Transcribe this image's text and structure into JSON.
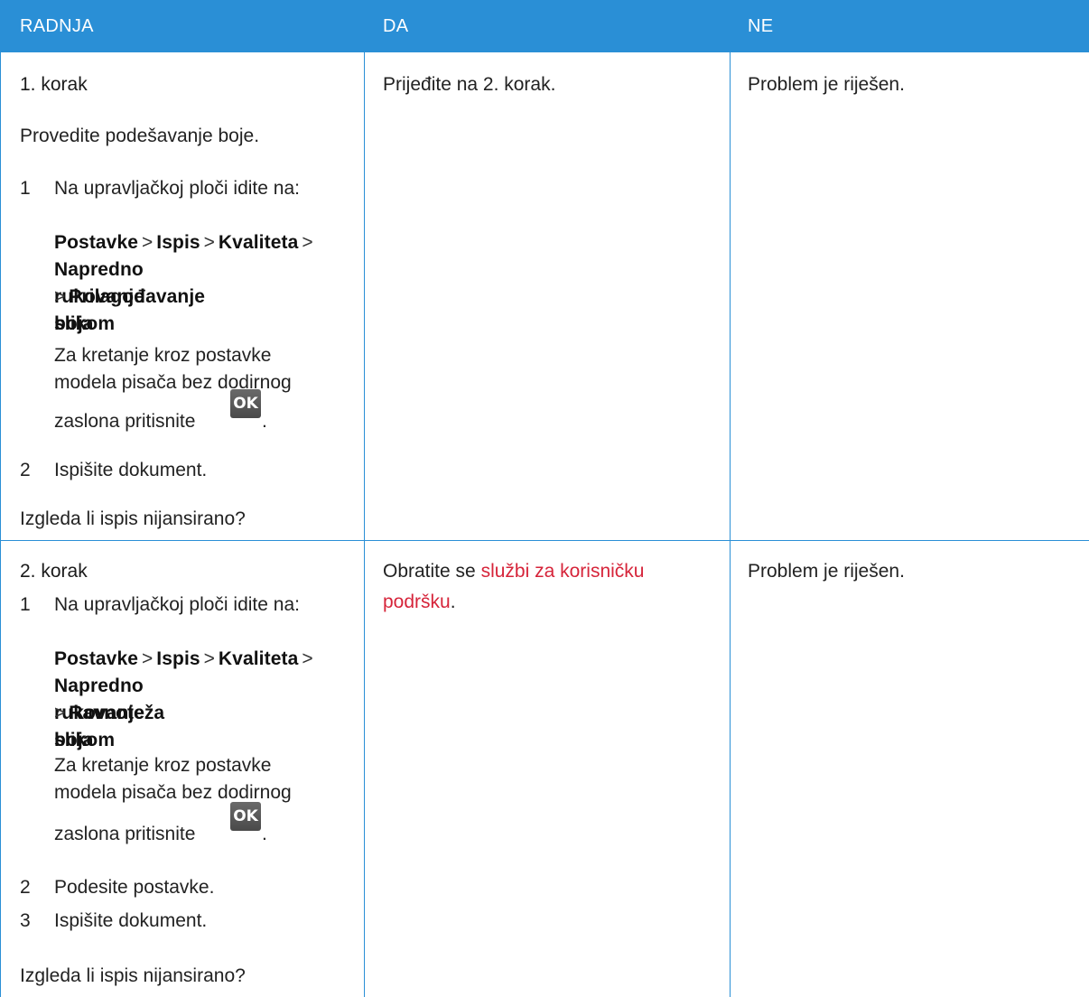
{
  "header": {
    "col1": "RADNJA",
    "col2": "DA",
    "col3": "NE"
  },
  "row1": {
    "step": "1. korak",
    "intro": "Provedite podešavanje boje.",
    "item1_num": "1",
    "item1_text": "Na upravljačkoj ploči idite na:",
    "path_line1_a": "Postavke",
    "path_line1_b": "Ispis",
    "path_line1_c": "Kvaliteta",
    "path_line2": "Napredno rukovanje slikom",
    "path_line3": "Prilagođavanje boja",
    "nontouch_line1": "Za kretanje kroz postavke",
    "nontouch_line2": "modela pisača bez dodirnog",
    "nontouch_line3": "zaslona pritisnite",
    "ok_label": "OK",
    "period": ".",
    "item2_num": "2",
    "item2_text": "Ispišite dokument.",
    "question": "Izgleda li ispis nijansirano?",
    "yes": "Prijeđite na 2. korak.",
    "no": "Problem je riješen."
  },
  "row2": {
    "step": "2. korak",
    "item1_num": "1",
    "item1_text": "Na upravljačkoj ploči idite na:",
    "path_line1_a": "Postavke",
    "path_line1_b": "Ispis",
    "path_line1_c": "Kvaliteta",
    "path_line2": "Napredno rukovanje slikom",
    "path_line3": "Ravnoteža boja",
    "nontouch_line1": "Za kretanje kroz postavke",
    "nontouch_line2": "modela pisača bez dodirnog",
    "nontouch_line3": "zaslona pritisnite",
    "ok_label": "OK",
    "period": ".",
    "item2_num": "2",
    "item2_text": "Podesite postavke.",
    "item3_num": "3",
    "item3_text": "Ispišite dokument.",
    "question": "Izgleda li ispis nijansirano?",
    "yes_prefix": "Obratite se",
    "yes_link_line1": "službi za korisničku",
    "yes_link_line2": "podršku",
    "yes_suffix": ".",
    "no": "Problem je riješen."
  },
  "symbols": {
    "separator": ">"
  },
  "colors": {
    "header": "#2a8fd6",
    "link": "#d6243a",
    "border": "#2a8fd6"
  }
}
